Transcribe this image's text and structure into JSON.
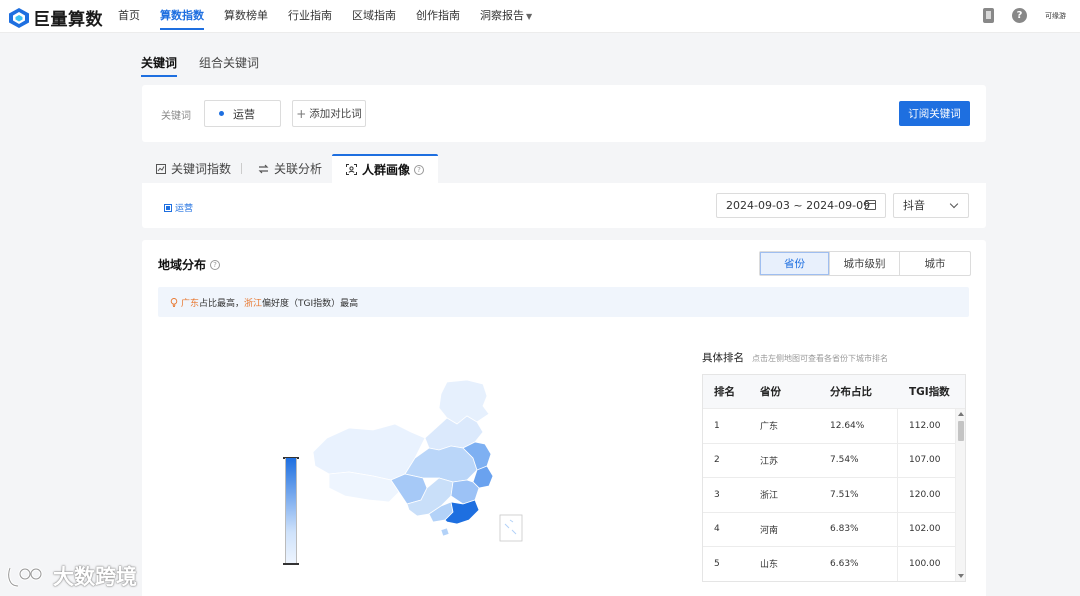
{
  "brand": {
    "name": "巨量算数"
  },
  "nav": {
    "items": [
      "首页",
      "算数指数",
      "算数榜单",
      "行业指南",
      "区域指南",
      "创作指南",
      "洞察报告"
    ],
    "active_index": 1
  },
  "user": {
    "name": "可缘游"
  },
  "subtabs": {
    "keyword": "关键词",
    "combo": "组合关键词"
  },
  "search": {
    "label": "关键词",
    "chip": "运营",
    "add_label": "添加对比词",
    "subscribe_label": "订阅关键词"
  },
  "tabs": {
    "index": "关键词指数",
    "relation": "关联分析",
    "persona": "人群画像"
  },
  "filter": {
    "legend_keyword": "运营",
    "date_range": "2024-09-03 ~ 2024-09-09",
    "platform": "抖音"
  },
  "region": {
    "title": "地域分布",
    "segments": [
      "省份",
      "城市级别",
      "城市"
    ],
    "insight": {
      "top_share": "广东",
      "text1": "占比最高，",
      "top_tgi": "浙江",
      "text2": "偏好度（TGI指数）最高"
    },
    "ranking": {
      "title": "具体排名",
      "hint": "点击左侧地图可查看各省份下城市排名",
      "columns": [
        "排名",
        "省份",
        "分布占比",
        "TGI指数"
      ],
      "rows": [
        {
          "rank": "1",
          "province": "广东",
          "share": "12.64%",
          "tgi": "112.00"
        },
        {
          "rank": "2",
          "province": "江苏",
          "share": "7.54%",
          "tgi": "107.00"
        },
        {
          "rank": "3",
          "province": "浙江",
          "share": "7.51%",
          "tgi": "120.00"
        },
        {
          "rank": "4",
          "province": "河南",
          "share": "6.83%",
          "tgi": "102.00"
        },
        {
          "rank": "5",
          "province": "山东",
          "share": "6.63%",
          "tgi": "100.00"
        }
      ]
    }
  },
  "watermark": {
    "text": "大数跨境"
  },
  "colors": {
    "accent": "#1e6fe0",
    "highlight": "#e8772e"
  }
}
